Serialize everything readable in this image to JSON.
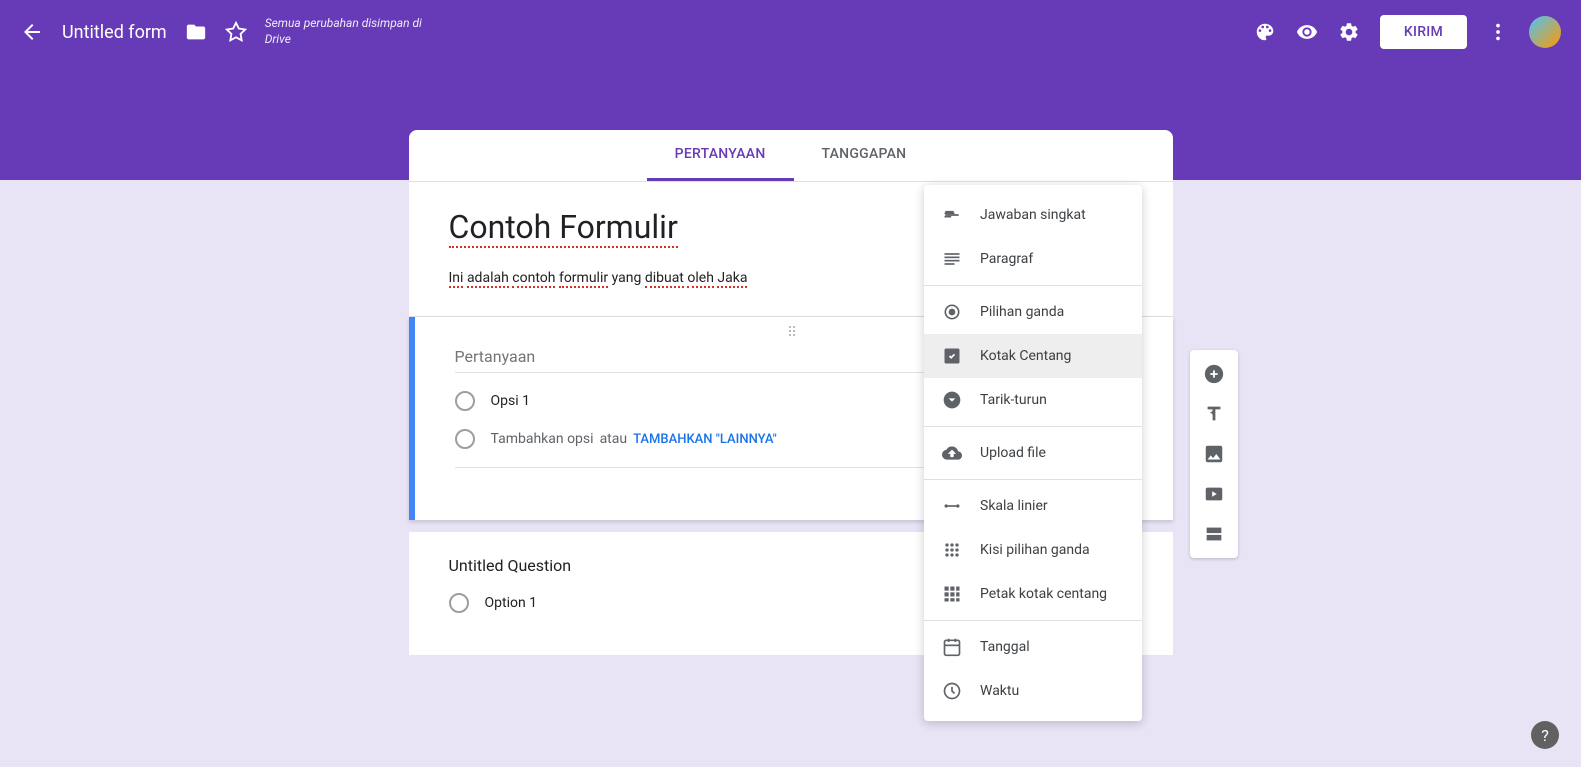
{
  "header": {
    "title": "Untitled form",
    "save_message": "Semua perubahan disimpan di Drive",
    "send_label": "KIRIM"
  },
  "tabs": {
    "questions": "PERTANYAAN",
    "responses": "TANGGAPAN"
  },
  "form": {
    "heading": "Contoh Formulir",
    "description_parts": [
      "Ini",
      "adalah",
      "contoh",
      "formulir",
      "yang",
      "dibuat",
      "oleh",
      "Jaka"
    ],
    "question_placeholder": "Pertanyaan",
    "option1": "Opsi 1",
    "add_option": "Tambahkan opsi",
    "or": "atau",
    "add_other": "TAMBAHKAN \"LAINNYA\""
  },
  "untitled": {
    "heading": "Untitled Question",
    "option1": "Option 1"
  },
  "dropdown": {
    "short_answer": "Jawaban singkat",
    "paragraph": "Paragraf",
    "multiple_choice": "Pilihan ganda",
    "checkbox": "Kotak Centang",
    "dropdown": "Tarik-turun",
    "file_upload": "Upload file",
    "linear_scale": "Skala linier",
    "mc_grid": "Kisi pilihan ganda",
    "checkbox_grid": "Petak kotak centang",
    "date": "Tanggal",
    "time": "Waktu"
  }
}
